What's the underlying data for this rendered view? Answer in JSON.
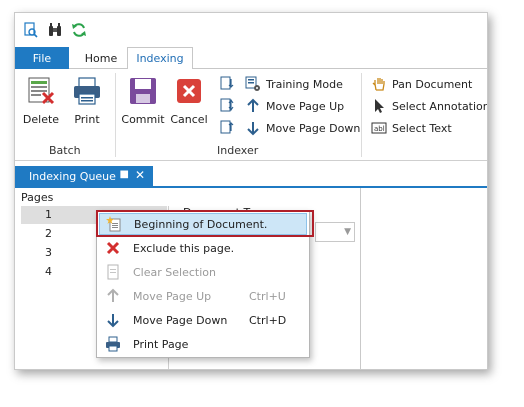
{
  "tabs": {
    "file": "File",
    "home": "Home",
    "indexing": "Indexing"
  },
  "ribbon": {
    "batch": {
      "label": "Batch",
      "delete": "Delete",
      "print": "Print"
    },
    "indexer": {
      "label": "Indexer",
      "commit": "Commit",
      "cancel": "Cancel",
      "training_mode": "Training Mode",
      "move_page_up": "Move Page Up",
      "move_page_down": "Move Page Down"
    },
    "view": {
      "pan_document": "Pan Document",
      "select_annotations": "Select Annotations",
      "select_text": "Select Text"
    }
  },
  "panel": {
    "title": "Indexing Queue",
    "pages_label": "Pages",
    "document_type_label": "Document Type",
    "pages": [
      "1",
      "2",
      "3",
      "4"
    ]
  },
  "context_menu": {
    "items": [
      {
        "label": "Beginning of Document.",
        "shortcut": ""
      },
      {
        "label": "Exclude this page.",
        "shortcut": ""
      },
      {
        "label": "Clear Selection",
        "shortcut": ""
      },
      {
        "label": "Move Page Up",
        "shortcut": "Ctrl+U"
      },
      {
        "label": "Move Page Down",
        "shortcut": "Ctrl+D"
      },
      {
        "label": "Print Page",
        "shortcut": ""
      }
    ]
  },
  "colors": {
    "accent": "#1f7ac3",
    "highlight_border": "#b0202a",
    "menu_hover": "#cde6f7"
  }
}
